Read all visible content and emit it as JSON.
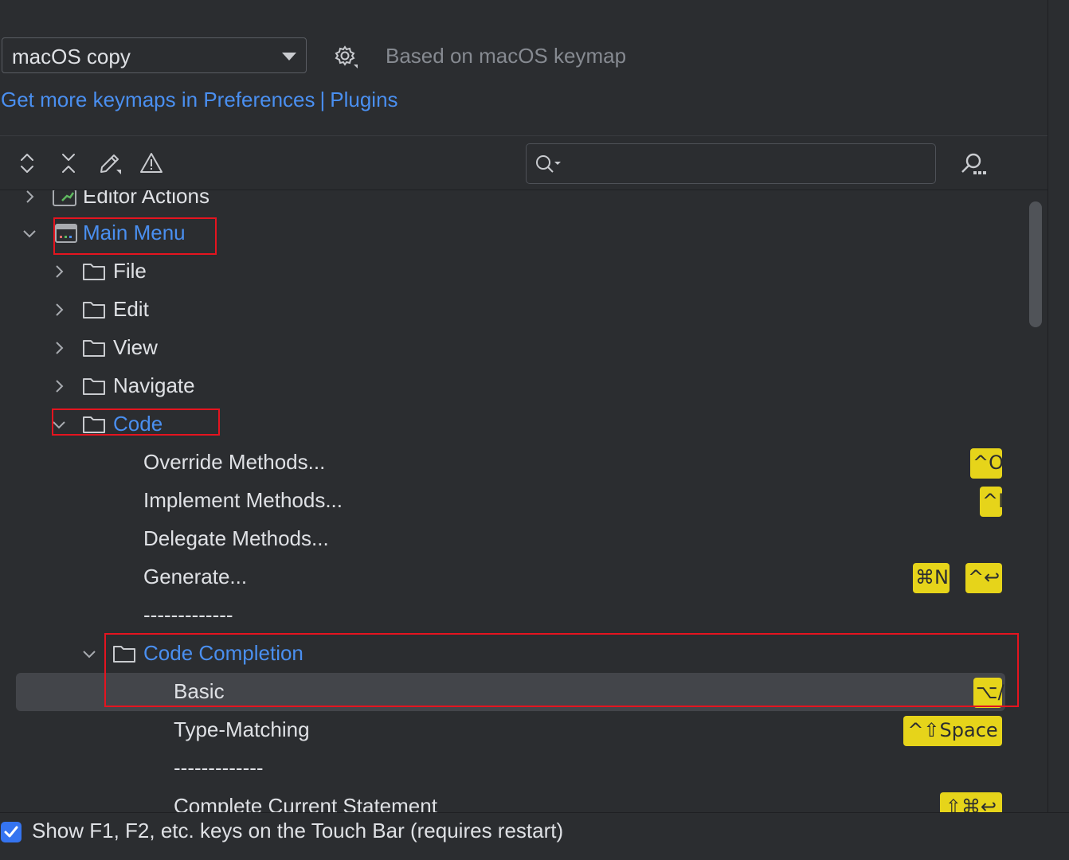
{
  "header": {
    "keymap_value": "macOS copy",
    "based_on": "Based on macOS keymap",
    "link_keymaps": "Get more keymaps in Preferences",
    "link_separator": "|",
    "link_plugins": "Plugins"
  },
  "toolbar": {
    "expand_icon": "expand-all-icon",
    "collapse_icon": "collapse-all-icon",
    "edit_icon": "edit-icon",
    "conflicts_icon": "warning-icon",
    "search_value": "",
    "find_shortcut_icon": "find-by-shortcut-icon"
  },
  "tree": {
    "editor_actions": "Editor Actions",
    "main_menu": "Main Menu",
    "file": "File",
    "edit": "Edit",
    "view": "View",
    "navigate": "Navigate",
    "code": "Code",
    "override_methods": "Override Methods...",
    "override_shortcut": "^O",
    "implement_methods": "Implement Methods...",
    "implement_shortcut": "^I",
    "delegate_methods": "Delegate Methods...",
    "generate": "Generate...",
    "generate_shortcut_1": "⌘N",
    "generate_shortcut_2": "^↩",
    "separator_1": "-------------",
    "code_completion": "Code Completion",
    "basic": "Basic",
    "basic_shortcut": "⌥/",
    "type_matching": "Type-Matching",
    "type_matching_shortcut": "^⇧Space",
    "separator_2": "-------------",
    "complete_current_statement": "Complete Current Statement",
    "complete_shortcut": "⇧⌘↩"
  },
  "footer": {
    "touchbar_checked": true,
    "touchbar_label": "Show F1, F2, etc. keys on the Touch Bar (requires restart)"
  },
  "colors": {
    "background": "#2b2d30",
    "link_blue": "#4a8ff0",
    "shortcut_yellow": "#e6d41a",
    "selection": "#43454a",
    "highlight_red": "#e5141f"
  }
}
